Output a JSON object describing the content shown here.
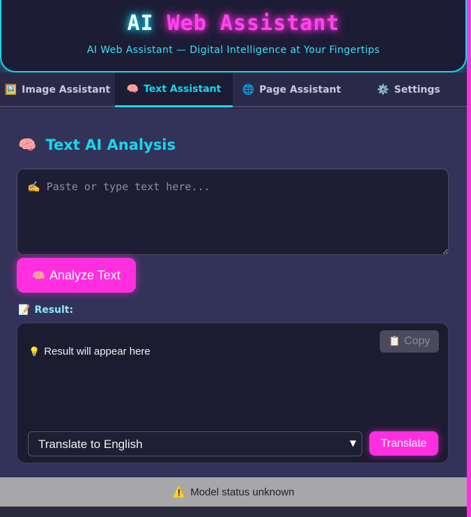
{
  "header": {
    "title_part1": "AI",
    "title_part2": "Web Assistant",
    "subtitle": "AI Web Assistant — Digital Intelligence at Your Fingertips"
  },
  "tabs": [
    {
      "icon": "🖼️",
      "icon_name": "image-icon",
      "label": "Image Assistant",
      "active": false
    },
    {
      "icon": "🧠",
      "icon_name": "brain-icon",
      "label": "Text Assistant",
      "active": true
    },
    {
      "icon": "🌐",
      "icon_name": "globe-icon",
      "label": "Page Assistant",
      "active": false
    },
    {
      "icon": "⚙️",
      "icon_name": "gear-icon",
      "label": "Settings",
      "active": false
    }
  ],
  "text_panel": {
    "heading_icon": "🧠",
    "heading": "Text AI Analysis",
    "input_placeholder": "✍️ Paste or type text here...",
    "input_value": "",
    "analyze_icon": "🧠",
    "analyze_label": "Analyze Text",
    "result_icon": "📝",
    "result_label": "Result:",
    "copy_icon": "📋",
    "copy_label": "Copy",
    "result_placeholder_icon": "💡",
    "result_placeholder": "Result will appear here",
    "translate_select_value": "Translate to English",
    "translate_label": "Translate"
  },
  "status": {
    "icon": "⚠️",
    "text": "Model status unknown"
  },
  "colors": {
    "accent_cyan": "#13d9f0",
    "accent_magenta": "#ff2fe0",
    "background": "#33335a",
    "status_bar": "#a7a7aa"
  }
}
